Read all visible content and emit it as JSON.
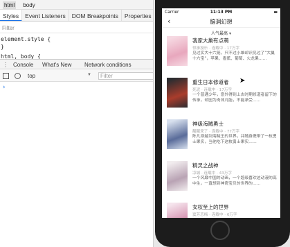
{
  "devtools": {
    "crumbs": [
      "html",
      "body"
    ],
    "panel_tabs": [
      "Styles",
      "Event Listeners",
      "DOM Breakpoints",
      "Properties"
    ],
    "filter_placeholder": "Filter",
    "code_lines": [
      "element.style {",
      "}",
      "html, body {"
    ],
    "console_tabs": [
      "Console",
      "What's New",
      "Network conditions"
    ],
    "context_select": "top",
    "console_filter_placeholder": "Filter",
    "prompt": "›"
  },
  "phone": {
    "status": {
      "carrier": "Carrier",
      "time": "11:13 PM",
      "battery": "▬"
    },
    "nav": {
      "back": "‹",
      "title": "脑洞幻想"
    },
    "sort_label": "人气最高 ▾",
    "books": [
      {
        "title": "我家大巢有点萌",
        "meta": "领承授乐 · 连载中 · 17万字",
        "desc": "见过实大十六笼，只不过小雄却识见过了“大巢十六宝”，苹果、香蕉、葡萄、火龙果……",
        "cover_colors": [
          "#f6d9e2",
          "#e8a7bd"
        ]
      },
      {
        "title": "重生日本修道者",
        "meta": "死泥 · 连载中 · 17万字",
        "desc": "一个普通少年，意外得到上古时期修道者留下的传承，却因为肉体凡胎，不能承受……",
        "cover_colors": [
          "#2d2d30",
          "#a93c2c"
        ]
      },
      {
        "title": "神级海贼勇士",
        "meta": "醒醒来了 · 连载中 · 77万字",
        "desc": "陈凡穿越到海贼王的世界，并随身携带了一枚勇士果实，当他吃下这枚勇士果实……",
        "cover_colors": [
          "#d7e0ee",
          "#5a6c9a"
        ]
      },
      {
        "title": "精灵之战神",
        "meta": "凉城 · 连载中 · 43万字",
        "desc": "一个风靡中国的动画，一个超级喜欢这动漫的高中生，一直想到神奇宝贝的世界的……",
        "cover_colors": [
          "#f1ecee",
          "#b9a3b4"
        ]
      },
      {
        "title": "女权至上的世界",
        "meta": "窦芳恋梅 · 连载中 · 6万字",
        "desc": "",
        "cover_colors": [
          "#f5e4ec",
          "#d796b3"
        ]
      }
    ]
  }
}
